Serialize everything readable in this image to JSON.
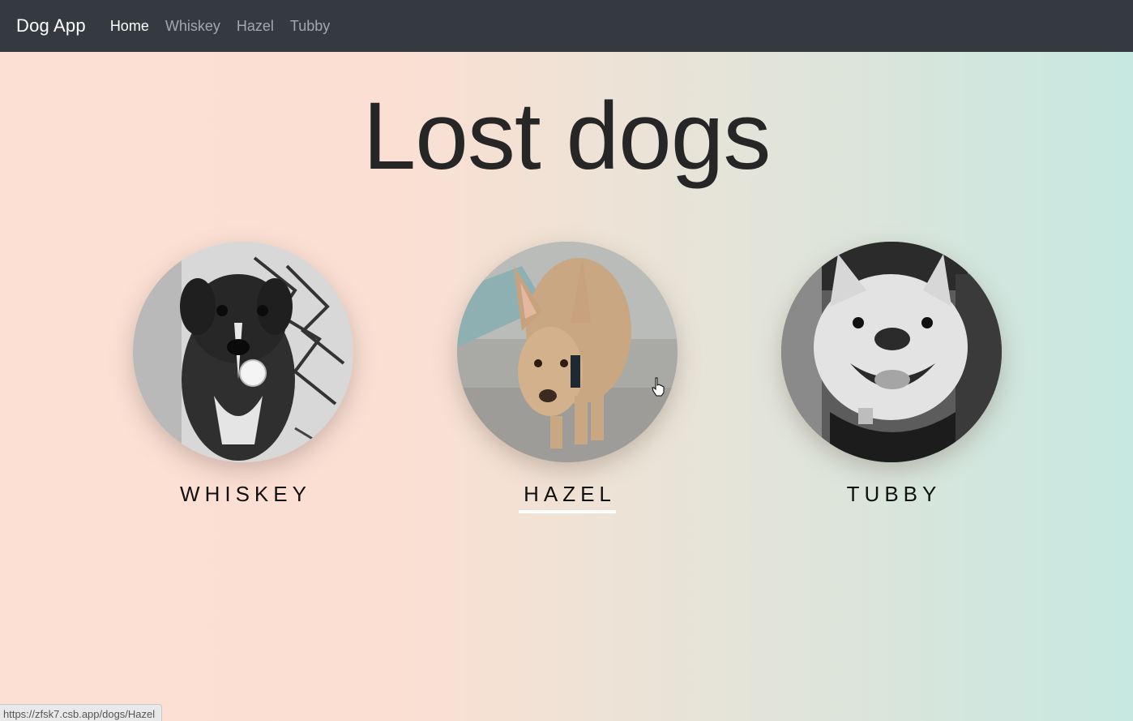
{
  "navbar": {
    "brand": "Dog App",
    "links": [
      {
        "label": "Home",
        "active": true
      },
      {
        "label": "Whiskey",
        "active": false
      },
      {
        "label": "Hazel",
        "active": false
      },
      {
        "label": "Tubby",
        "active": false
      }
    ]
  },
  "main": {
    "title": "Lost dogs",
    "dogs": [
      {
        "name": "WHISKEY",
        "photo": "black-and-white photo of a small dog with a pacifier"
      },
      {
        "name": "HAZEL",
        "photo": "color photo of a tan dog with large ears",
        "hovered": true
      },
      {
        "name": "TUBBY",
        "photo": "black-and-white photo of a smiling bulldog"
      }
    ]
  },
  "status_bar": {
    "url": "https://zfsk7.csb.app/dogs/Hazel"
  },
  "colors": {
    "navbar_bg": "#343a40",
    "gradient_left": "#fde0d4",
    "gradient_right": "#c6e8e1",
    "hover_underline": "#ffffff"
  }
}
